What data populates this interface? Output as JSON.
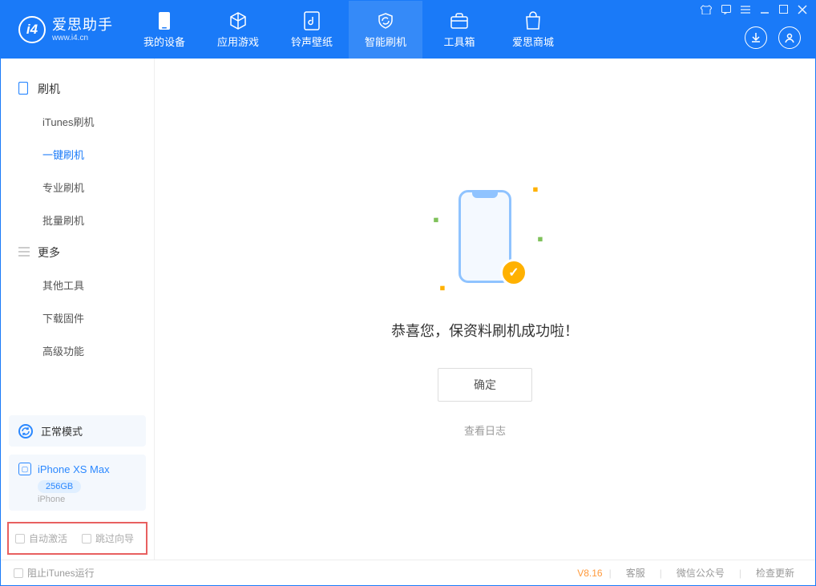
{
  "app": {
    "title": "爱思助手",
    "subtitle": "www.i4.cn"
  },
  "nav": {
    "my_device": "我的设备",
    "apps_games": "应用游戏",
    "ringtones": "铃声壁纸",
    "flash": "智能刷机",
    "toolbox": "工具箱",
    "store": "爱思商城"
  },
  "sidebar": {
    "section_flash": "刷机",
    "items_flash": {
      "itunes": "iTunes刷机",
      "oneclick": "一键刷机",
      "pro": "专业刷机",
      "batch": "批量刷机"
    },
    "section_more": "更多",
    "items_more": {
      "other_tools": "其他工具",
      "download_fw": "下载固件",
      "advanced": "高级功能"
    }
  },
  "device_status": {
    "mode": "正常模式"
  },
  "device": {
    "name": "iPhone XS Max",
    "capacity": "256GB",
    "type": "iPhone"
  },
  "bottom_checks": {
    "auto_activate": "自动激活",
    "skip_guide": "跳过向导"
  },
  "main": {
    "success_title": "恭喜您，保资料刷机成功啦！",
    "ok_button": "确定",
    "view_log": "查看日志"
  },
  "footer": {
    "stop_itunes": "阻止iTunes运行",
    "version": "V8.16",
    "support": "客服",
    "wechat": "微信公众号",
    "check_update": "检查更新"
  }
}
